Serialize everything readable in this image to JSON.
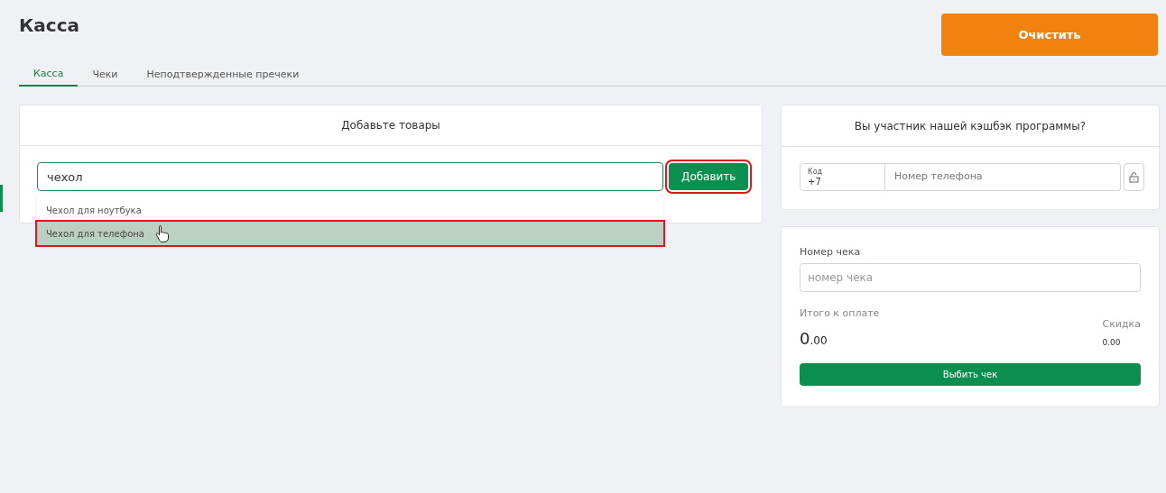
{
  "page_title": "Касса",
  "clear_button": "Очистить",
  "tabs": [
    {
      "label": "Касса",
      "selected": true
    },
    {
      "label": "Чеки",
      "selected": false
    },
    {
      "label": "Неподтвержденные пречеки",
      "selected": false
    }
  ],
  "add_card": {
    "title": "Добавьте товары",
    "search": {
      "value": "чехол"
    },
    "add_button": {
      "label": "Добавить",
      "highlighted": true
    },
    "suggestions": [
      {
        "label": "Чехол для ноутбука",
        "selected": false
      },
      {
        "label": "Чехол для телефона",
        "selected": true
      }
    ]
  },
  "cashback_card": {
    "title": "Вы участник нашей кэшбэк программы?",
    "code_label": "Код",
    "code_value": "+7",
    "phone": {
      "placeholder": "Номер телефона"
    }
  },
  "receipt_card": {
    "receipt_label": "Номер чека",
    "receipt_field": {
      "placeholder": "номер чека"
    },
    "total_label": "Итого к оплате",
    "total_integer": "0",
    "total_fraction": ".00",
    "discount_label": "Скидка",
    "discount_value": "0.00",
    "submit_button": "Выбить чек"
  }
}
